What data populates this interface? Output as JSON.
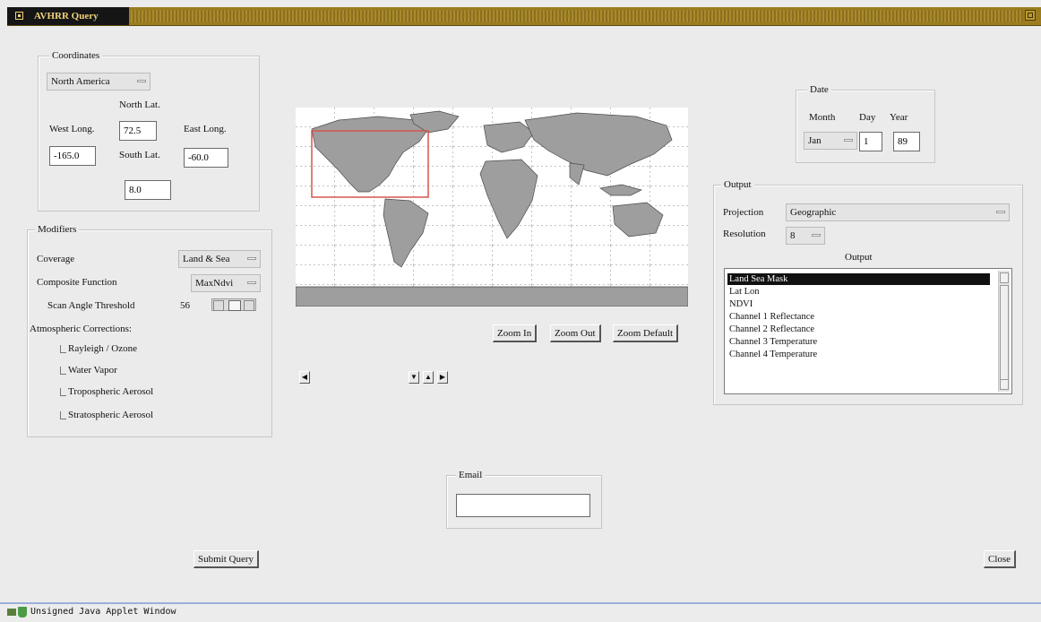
{
  "window": {
    "title": "AVHRR Query"
  },
  "coordinates": {
    "legend": "Coordinates",
    "region": "North America",
    "north_lat_label": "North Lat.",
    "north_lat": "72.5",
    "west_long_label": "West Long.",
    "west_long": "-165.0",
    "east_long_label": "East Long.",
    "east_long": "-60.0",
    "south_lat_label": "South Lat.",
    "south_lat": "8.0"
  },
  "modifiers": {
    "legend": "Modifiers",
    "coverage_label": "Coverage",
    "coverage_value": "Land & Sea",
    "composite_label": "Composite Function",
    "composite_value": "MaxNdvi",
    "scan_angle_label": "Scan Angle Threshold",
    "scan_angle_value": "56",
    "atmo_label": "Atmospheric Corrections:",
    "checks": [
      {
        "label": "Rayleigh / Ozone"
      },
      {
        "label": "Water Vapor"
      },
      {
        "label": "Tropospheric Aerosol"
      },
      {
        "label": "Stratospheric Aerosol"
      }
    ]
  },
  "date": {
    "legend": "Date",
    "month_label": "Month",
    "day_label": "Day",
    "year_label": "Year",
    "month_value": "Jan",
    "day_value": "1",
    "year_value": "89"
  },
  "output": {
    "legend": "Output",
    "projection_label": "Projection",
    "projection_value": "Geographic",
    "resolution_label": "Resolution",
    "resolution_value": "8",
    "list_title": "Output",
    "list_items": [
      "Land Sea Mask",
      "Lat Lon",
      "NDVI",
      "Channel 1 Reflectance",
      "Channel 2 Reflectance",
      "Channel 3 Temperature",
      "Channel 4 Temperature"
    ],
    "selected_index": 0
  },
  "map": {
    "zoom_in": "Zoom In",
    "zoom_out": "Zoom Out",
    "zoom_default": "Zoom Default",
    "colors": {
      "land": "#9e9e9e",
      "ocean": "#ffffff",
      "selection": "#d9534f"
    }
  },
  "email": {
    "legend": "Email",
    "value": ""
  },
  "buttons": {
    "submit": "Submit Query",
    "close": "Close"
  },
  "statusbar": {
    "text": "Unsigned Java Applet Window"
  }
}
